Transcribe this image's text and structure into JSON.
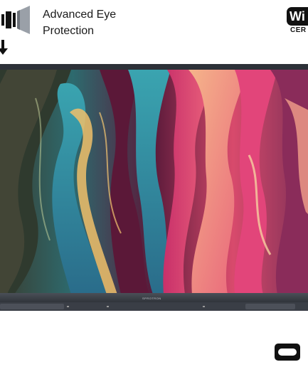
{
  "feature": {
    "line1": "Advanced Eye",
    "line2": "Protection",
    "icon": "eye-protection-filter-icon",
    "arrow_icon": "arrow-down-icon"
  },
  "badge": {
    "top": "Wi",
    "bottom": "CER"
  },
  "display": {
    "brand": "SPROTRON"
  },
  "bottom_icon": "vr-headset-icon",
  "colors": {
    "bezel": "#2d3138",
    "accent_pink": "#e6508a",
    "accent_teal": "#2d8a9a"
  }
}
